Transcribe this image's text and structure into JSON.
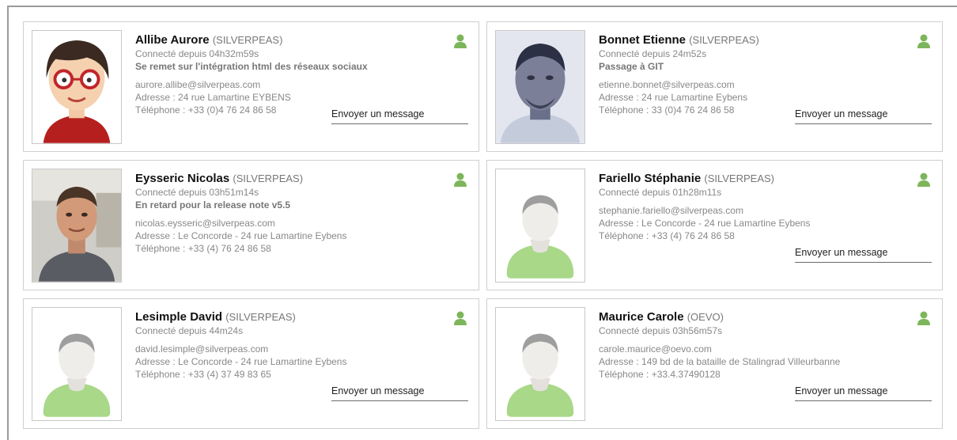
{
  "contacts": [
    {
      "name": "Allibe Aurore",
      "organization": "(SILVERPEAS)",
      "connected": "Connecté depuis 04h32m59s",
      "status": "Se remet sur l'intégration html des réseaux sociaux",
      "email": "aurore.allibe@silverpeas.com",
      "address": "Adresse : 24 rue Lamartine EYBENS",
      "phone": "Téléphone : +33 (0)4 76 24 86 58",
      "message_label": "Envoyer un message",
      "avatar": "cartoon-avatar",
      "online_icon": "user-online-icon"
    },
    {
      "name": "Bonnet Etienne",
      "organization": "(SILVERPEAS)",
      "connected": "Connecté depuis 24m52s",
      "status": "Passage à GIT",
      "email": "etienne.bonnet@silverpeas.com",
      "address": "Adresse : 24 rue Lamartine Eybens",
      "phone": "Téléphone : 33 (0)4 76 24 86 58",
      "message_label": "Envoyer un message",
      "avatar": "photo-avatar",
      "online_icon": "user-online-icon"
    },
    {
      "name": "Eysseric Nicolas",
      "organization": "(SILVERPEAS)",
      "connected": "Connecté depuis 03h51m14s",
      "status": "En retard pour la release note v5.5",
      "email": "nicolas.eysseric@silverpeas.com",
      "address": "Adresse : Le Concorde - 24 rue Lamartine Eybens",
      "phone": "Téléphone : +33 (4) 76 24 86 58",
      "message_label": "",
      "avatar": "photo-avatar",
      "online_icon": "user-online-icon"
    },
    {
      "name": "Fariello Stéphanie",
      "organization": "(SILVERPEAS)",
      "connected": "Connecté depuis 01h28m11s",
      "status": "",
      "email": "stephanie.fariello@silverpeas.com",
      "address": "Adresse : Le Concorde - 24 rue Lamartine Eybens",
      "phone": "Téléphone : +33 (4) 76 24 86 58",
      "message_label": "Envoyer un message",
      "avatar": "default-avatar",
      "online_icon": "user-online-icon"
    },
    {
      "name": "Lesimple David",
      "organization": "(SILVERPEAS)",
      "connected": "Connecté depuis 44m24s",
      "status": "",
      "email": "david.lesimple@silverpeas.com",
      "address": "Adresse : Le Concorde - 24 rue Lamartine Eybens",
      "phone": "Téléphone : +33 (4) 37 49 83 65",
      "message_label": "Envoyer un message",
      "avatar": "default-avatar",
      "online_icon": "user-online-icon"
    },
    {
      "name": "Maurice Carole",
      "organization": "(OEVO)",
      "connected": "Connecté depuis 03h56m57s",
      "status": "",
      "email": "carole.maurice@oevo.com",
      "address": "Adresse : 149 bd de la bataille de Stalingrad Villeurbanne",
      "phone": "Téléphone : +33.4.37490128",
      "message_label": "Envoyer un message",
      "avatar": "default-avatar",
      "online_icon": "user-online-icon"
    }
  ],
  "colors": {
    "online_green": "#7db65a",
    "default_avatar_shirt": "#a8d888",
    "name_text": "#111111",
    "meta_text": "#888888"
  }
}
